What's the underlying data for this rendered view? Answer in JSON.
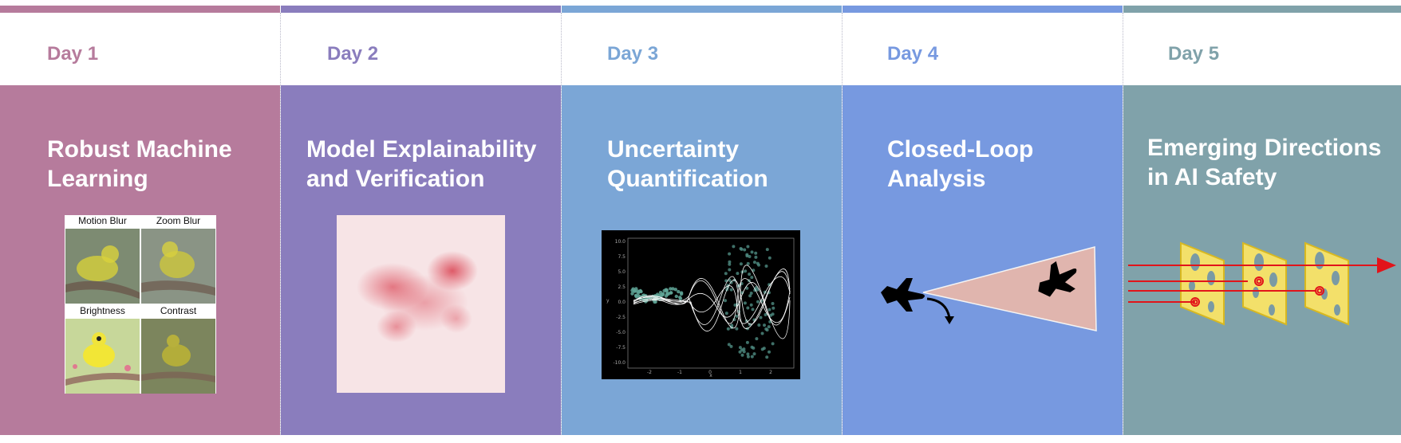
{
  "days": [
    {
      "day_label": "Day 1",
      "title_line1": "Robust Machine",
      "title_line2": "Learning",
      "color": "#b67b9c"
    },
    {
      "day_label": "Day 2",
      "title_line1": "Model Explainability",
      "title_line2": "and Verification",
      "color": "#8a7dbd"
    },
    {
      "day_label": "Day 3",
      "title_line1": "Uncertainty",
      "title_line2": "Quantification",
      "color": "#7ba6d6"
    },
    {
      "day_label": "Day 4",
      "title_line1": "Closed-Loop",
      "title_line2": "Analysis",
      "color": "#7799e0"
    },
    {
      "day_label": "Day 5",
      "title_line1": "Emerging Directions",
      "title_line2": "in AI Safety",
      "color": "#80a2aa"
    }
  ],
  "day1_figure": {
    "captions": [
      "Motion Blur",
      "Zoom Blur",
      "Brightness",
      "Contrast"
    ]
  },
  "day3_plot": {
    "yticks": [
      "10.0",
      "7.5",
      "5.0",
      "2.5",
      "0.0",
      "-2.5",
      "-5.0",
      "-7.5",
      "-10.0"
    ],
    "xticks": [
      "-2",
      "-1",
      "0",
      "1",
      "2"
    ],
    "xlabel": "x",
    "ylabel": "y"
  },
  "icons": {
    "day4": [
      "airplane-icon",
      "arrow-icon"
    ],
    "day5": [
      "swiss-cheese-icon",
      "arrow-icon"
    ]
  }
}
